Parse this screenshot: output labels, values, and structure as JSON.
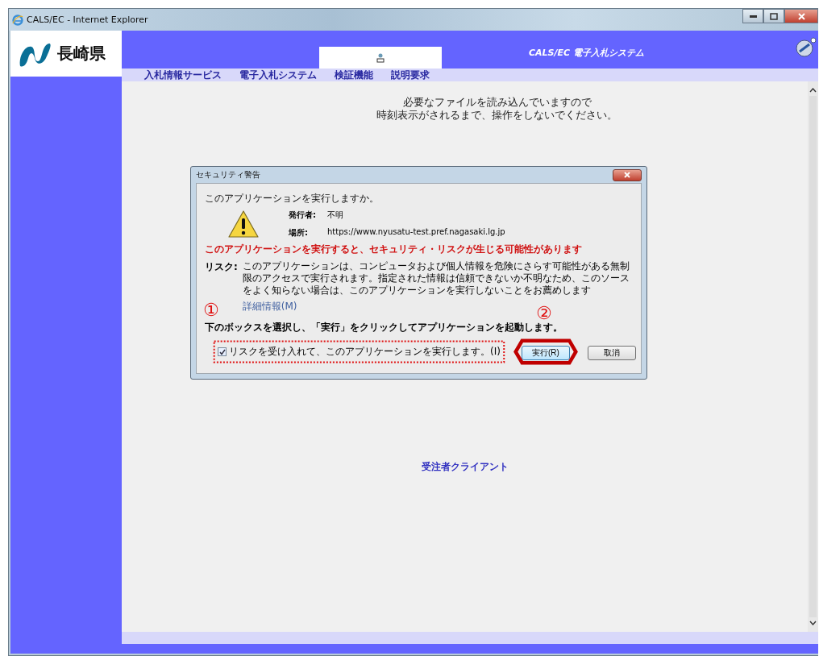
{
  "window": {
    "title": "CALS/EC - Internet Explorer"
  },
  "header": {
    "logo_text": "長崎県",
    "system_title": "CALS/EC 電子入札システム"
  },
  "nav": [
    {
      "label": "入札情報サービス"
    },
    {
      "label": "電子入札システム"
    },
    {
      "label": "検証機能"
    },
    {
      "label": "説明要求"
    }
  ],
  "message": [
    "必要なファイルを読み込んでいますので",
    "時刻表示がされるまで、操作をしないでください。"
  ],
  "dialog": {
    "title": "セキュリティ警告",
    "question": "このアプリケーションを実行しますか。",
    "fields": [
      {
        "label": "発行者:",
        "value": "不明"
      },
      {
        "label": "場所:",
        "value": "https://www.nyusatu-test.pref.nagasaki.lg.jp"
      }
    ],
    "warning": "このアプリケーションを実行すると、セキュリティ・リスクが生じる可能性があります",
    "risk_label": "リスク:",
    "risk_text": "このアプリケーションは、コンピュータおよび個人情報を危険にさらす可能性がある無制限のアクセスで実行されます。指定された情報は信頼できないか不明なため、このソースをよく知らない場合は、このアプリケーションを実行しないことをお薦めします",
    "details_link": "詳細情報(M)",
    "instruction": "下のボックスを選択し、「実行」をクリックしてアプリケーションを起動します。",
    "checkbox": {
      "label": "リスクを受け入れて、このアプリケーションを実行します。(I)",
      "checked": true
    },
    "buttons": [
      {
        "label": "実行(R)",
        "default": true
      },
      {
        "label": "取消",
        "default": false
      }
    ]
  },
  "annotations": [
    {
      "mark": "①"
    },
    {
      "mark": "②"
    }
  ],
  "client_link": "受注者クライアント"
}
